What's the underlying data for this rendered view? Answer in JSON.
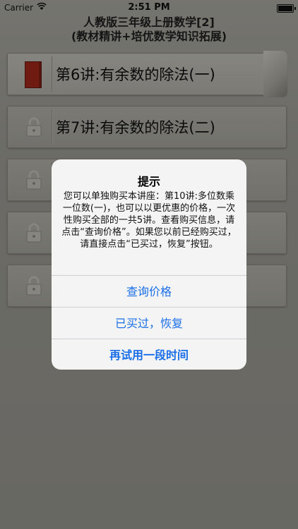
{
  "status_bar": {
    "carrier": "Carrier",
    "time": "2:51 PM"
  },
  "header": {
    "title_line1": "人教版三年级上册数学[2]",
    "title_line2": "(教材精讲+培优数学知识拓展)"
  },
  "lessons": [
    {
      "label": "第6讲:有余数的除法(一)",
      "icon": "book-icon",
      "locked": false
    },
    {
      "label": "第7讲:有余数的除法(二)",
      "icon": "lock-icon",
      "locked": true
    },
    {
      "label": "",
      "icon": "lock-icon",
      "locked": true
    },
    {
      "label": "",
      "icon": "lock-icon",
      "locked": true
    },
    {
      "label": "",
      "icon": "lock-icon",
      "locked": true
    }
  ],
  "alert": {
    "title": "提示",
    "message": "您可以单独购买本讲座：第10讲:多位数乘一位数(一)，也可以以更优惠的价格，一次性购买全部的一共5讲。查看购买信息，请点击“查询价格”。如果您以前已经购买过，请直接点击“已买过，恢复”按钮。",
    "buttons": [
      "查询价格",
      "已买过，恢复",
      "再试用一段时间"
    ]
  },
  "colors": {
    "accent": "#1a6fe8",
    "book": "#b42c1e"
  }
}
